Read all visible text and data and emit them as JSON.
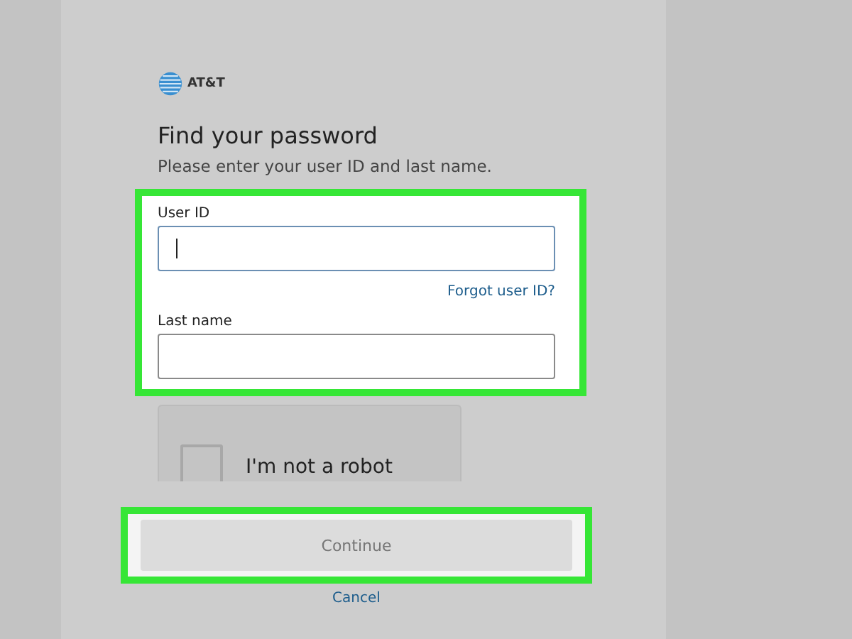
{
  "brand": {
    "name": "AT&T"
  },
  "heading": "Find your password",
  "subtitle": "Please enter your user ID and last name.",
  "fields": [
    {
      "label": "User ID",
      "focused": true,
      "link": "Forgot user ID?"
    },
    {
      "label": "Last name",
      "focused": false
    }
  ],
  "captcha": {
    "label": "I'm not a robot",
    "checked": false
  },
  "continue_button": {
    "label": "Continue",
    "disabled": true
  },
  "cancel_link": "Cancel"
}
